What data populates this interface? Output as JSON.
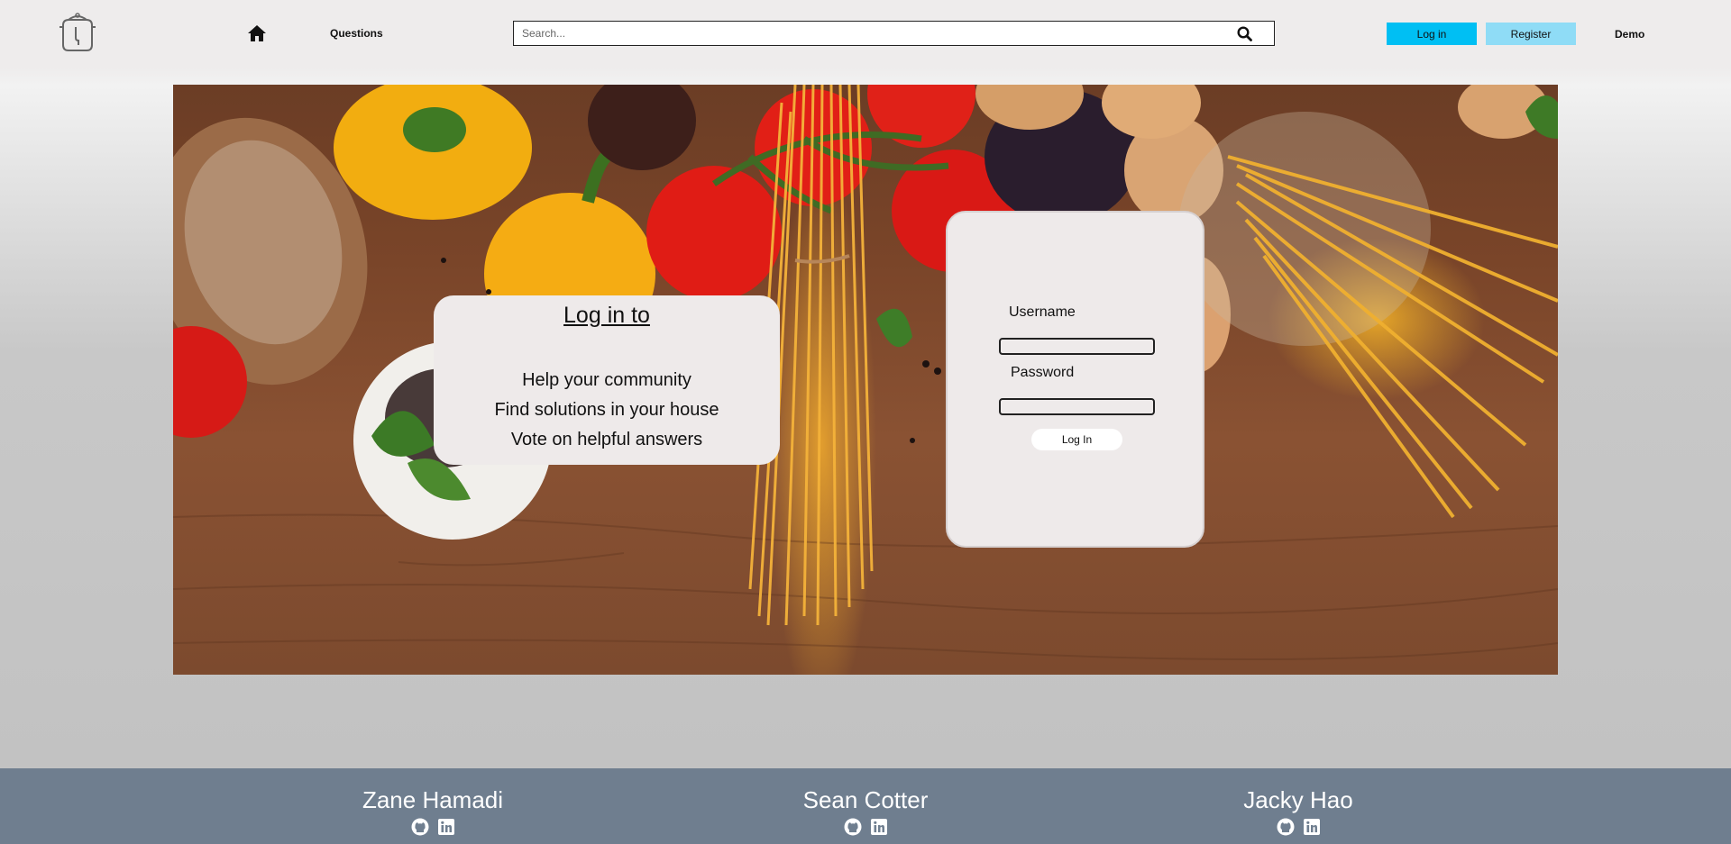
{
  "navbar": {
    "logo_icon": "pressure-cooker-logo",
    "home_icon": "home-icon",
    "questions_label": "Questions",
    "search_placeholder": "Search...",
    "search_icon": "search-icon",
    "login_label": "Log in",
    "register_label": "Register",
    "demo_label": "Demo",
    "colors": {
      "login_button": "#00bff3",
      "register_button": "#8fdcf6",
      "background": "#eeecec"
    }
  },
  "hero": {
    "info": {
      "title": "Log in to",
      "lines": [
        "Help your community",
        "Find solutions in your house",
        "Vote on helpful answers"
      ]
    },
    "login_form": {
      "username_label": "Username",
      "password_label": "Password",
      "submit_label": "Log In"
    }
  },
  "footer": {
    "background": "#6f7e8f",
    "developers": [
      {
        "name": "Zane Hamadi",
        "icons": [
          "github-icon",
          "linkedin-icon"
        ]
      },
      {
        "name": "Sean Cotter",
        "icons": [
          "github-icon",
          "linkedin-icon"
        ]
      },
      {
        "name": "Jacky Hao",
        "icons": [
          "github-icon",
          "linkedin-icon"
        ]
      }
    ]
  }
}
